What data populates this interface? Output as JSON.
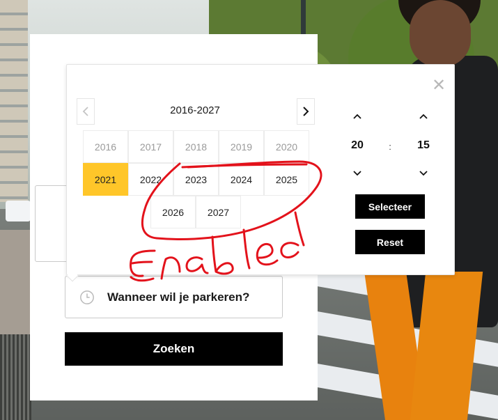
{
  "popup": {
    "year_range": "2016-2027",
    "years": [
      {
        "label": "2016",
        "state": "disabled"
      },
      {
        "label": "2017",
        "state": "disabled"
      },
      {
        "label": "2018",
        "state": "disabled"
      },
      {
        "label": "2019",
        "state": "disabled"
      },
      {
        "label": "2020",
        "state": "disabled"
      },
      {
        "label": "2021",
        "state": "selected"
      },
      {
        "label": "2022",
        "state": "enabled"
      },
      {
        "label": "2023",
        "state": "enabled"
      },
      {
        "label": "2024",
        "state": "enabled"
      },
      {
        "label": "2025",
        "state": "enabled"
      },
      {
        "label": "2026",
        "state": "enabled"
      },
      {
        "label": "2027",
        "state": "enabled"
      }
    ],
    "time": {
      "hours": "20",
      "separator": ":",
      "minutes": "15"
    },
    "select_label": "Selecteer",
    "reset_label": "Reset",
    "close_icon": "close-icon",
    "selected_color": "#ffc629"
  },
  "form": {
    "when_label": "Wanneer wil je parkeren?",
    "search_label": "Zoeken"
  },
  "annotation": {
    "text": "Enabled",
    "color": "#e3121b"
  }
}
